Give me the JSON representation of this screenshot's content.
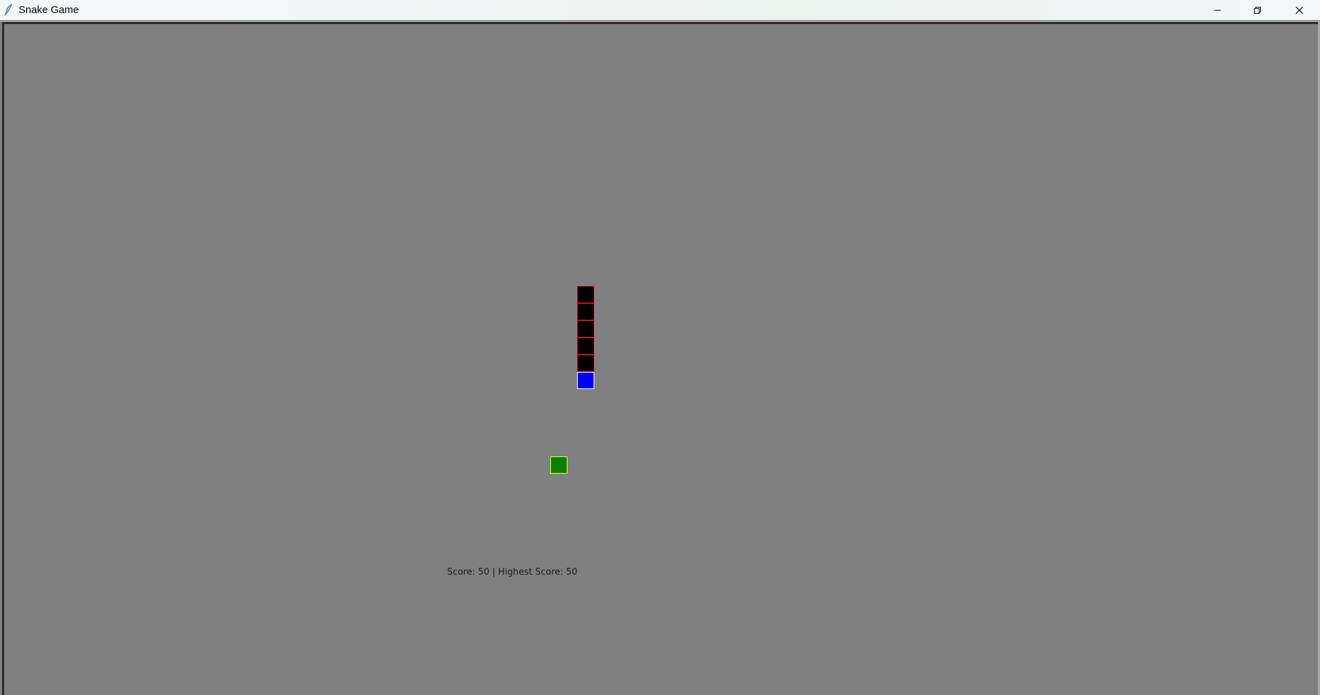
{
  "window": {
    "title": "Snake Game",
    "icons": {
      "app": "feather-icon",
      "minimize": "minimize-icon",
      "maximize": "restore-icon",
      "close": "close-icon"
    }
  },
  "game": {
    "background_color": "#808080",
    "snake": {
      "body_color": "#000000",
      "body_outline": "#d01010",
      "head_color": "#0000ff",
      "head_outline": "#ffffff",
      "length": 6
    },
    "food": {
      "color": "#008000",
      "outline": "#ffff00"
    },
    "score_text": "Score: 50 | Highest Score: 50"
  }
}
